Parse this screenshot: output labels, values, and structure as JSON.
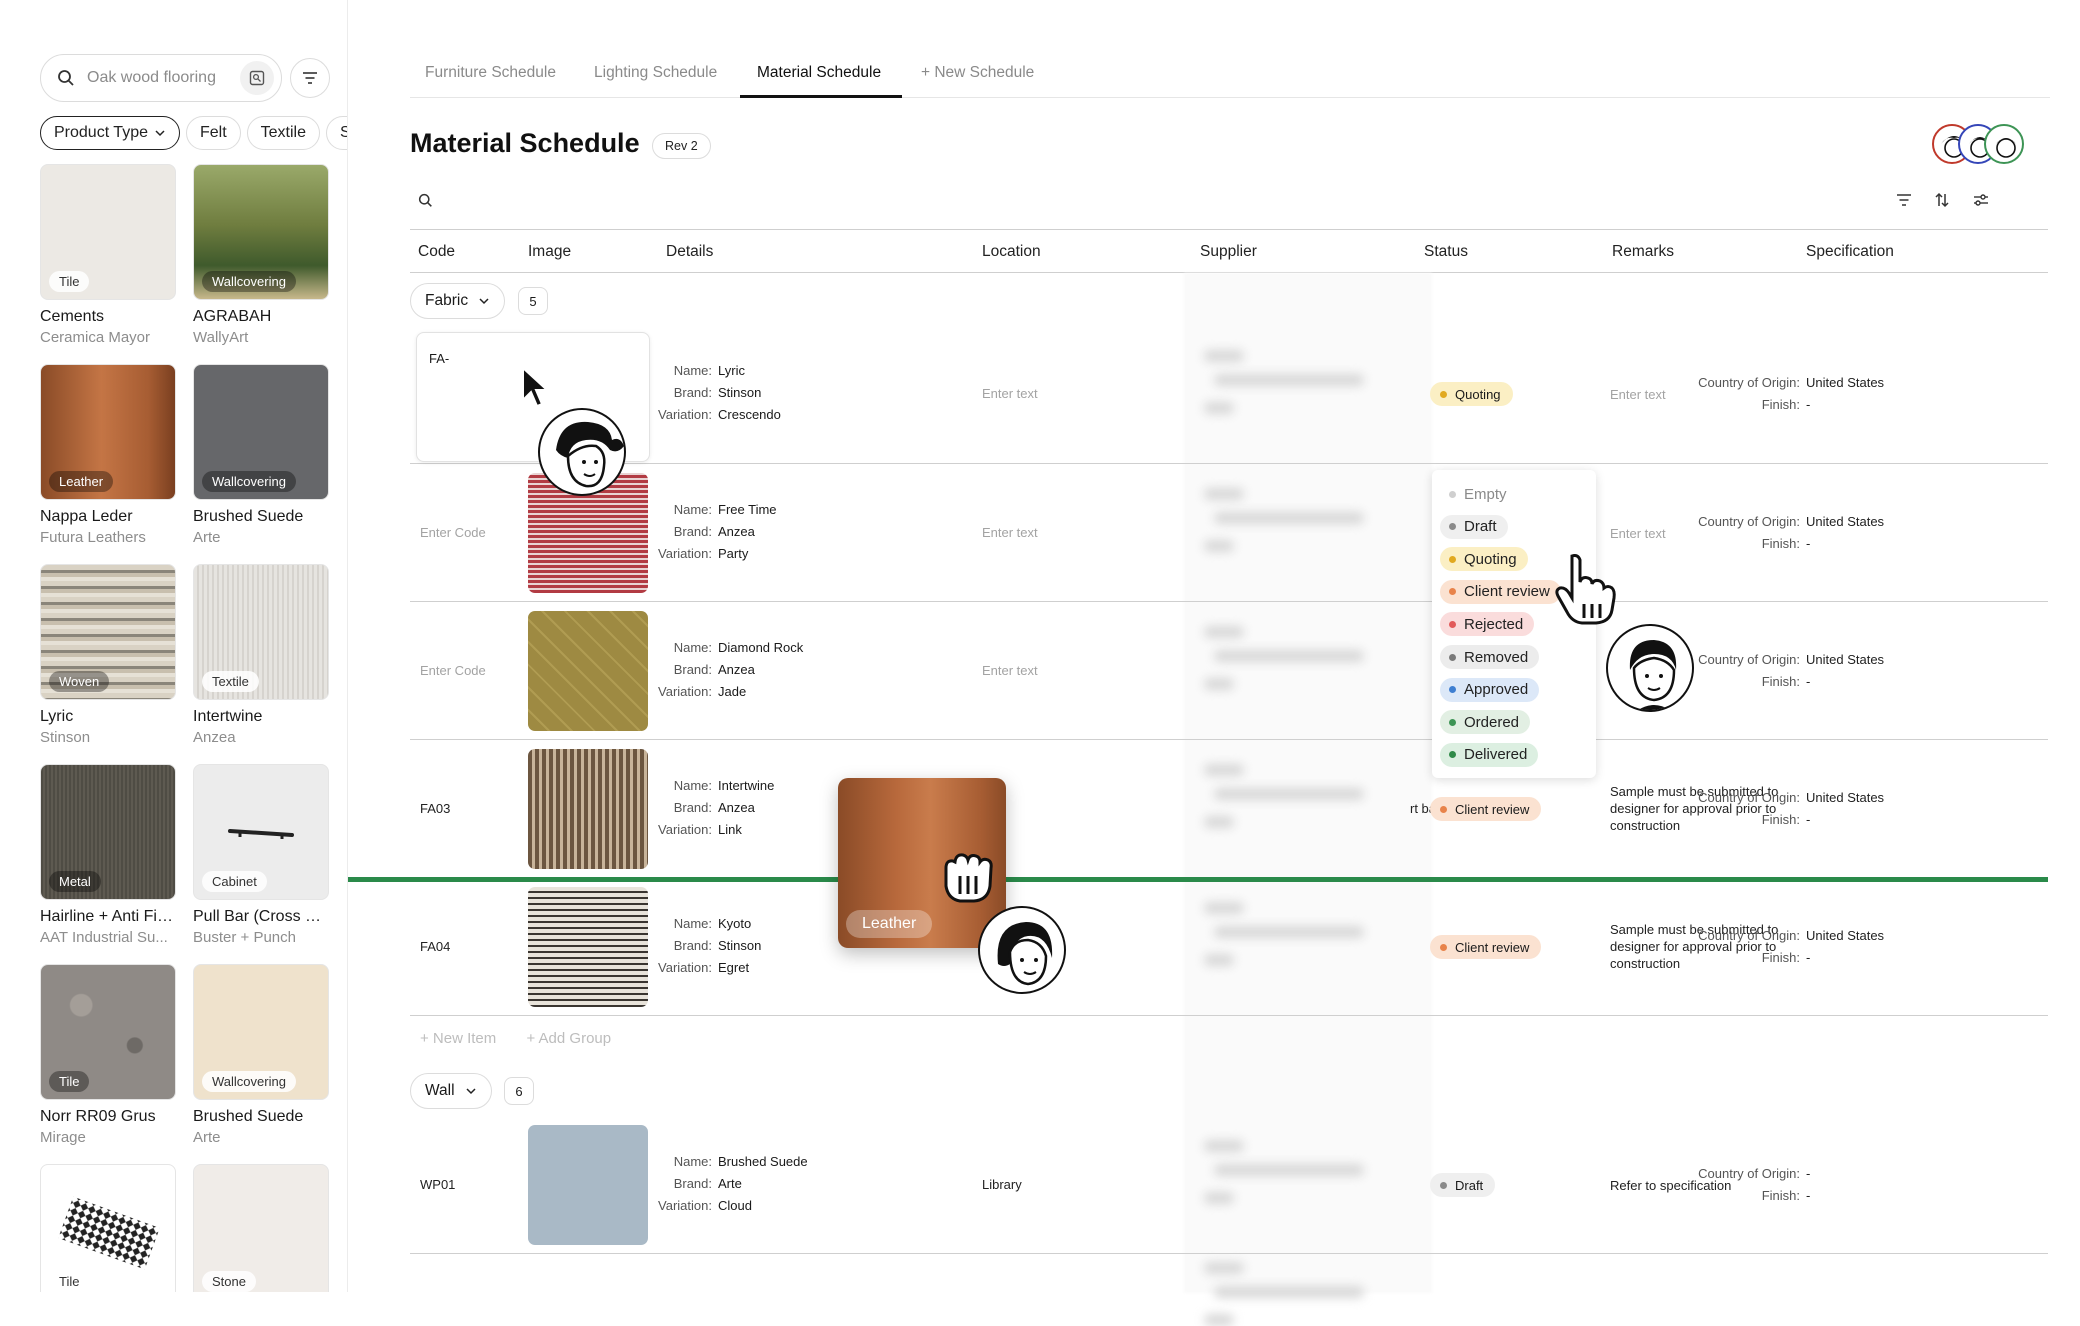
{
  "sidebar": {
    "search": {
      "placeholder": "Oak wood flooring"
    },
    "chips": [
      "Product Type",
      "Felt",
      "Textile",
      "S"
    ],
    "cards": [
      {
        "badge": "Tile",
        "name": "Cements",
        "brand": "Ceramica Mayor",
        "color": "#ece9e4"
      },
      {
        "badge": "Wallcovering",
        "name": "AGRABAH",
        "brand": "WallyArt",
        "color": "#5b6b3a"
      },
      {
        "badge": "Leather",
        "name": "Nappa Leder",
        "brand": "Futura Leathers",
        "color": "#a85a30"
      },
      {
        "badge": "Wallcovering",
        "name": "Brushed Suede",
        "brand": "Arte",
        "color": "#66676a"
      },
      {
        "badge": "Woven",
        "name": "Lyric",
        "brand": "Stinson",
        "color": "#b9b3a8"
      },
      {
        "badge": "Textile",
        "name": "Intertwine",
        "brand": "Anzea",
        "color": "#e4e2df"
      },
      {
        "badge": "Metal",
        "name": "Hairline + Anti Fin...",
        "brand": "AAT Industrial Su...",
        "color": "#55524a"
      },
      {
        "badge": "Cabinet",
        "name": "Pull Bar (Cross Bl...",
        "brand": "Buster + Punch",
        "color": "#ececec"
      },
      {
        "badge": "Tile",
        "name": "Norr RR09 Grus",
        "brand": "Mirage",
        "color": "#8f8a86"
      },
      {
        "badge": "Wallcovering",
        "name": "Brushed Suede",
        "brand": "Arte",
        "color": "#efe2cc"
      },
      {
        "badge": "Tile",
        "name": "",
        "brand": "",
        "color": "#ffffff"
      },
      {
        "badge": "Stone",
        "name": "",
        "brand": "",
        "color": "#f0ece8"
      }
    ]
  },
  "tabs": [
    "Furniture Schedule",
    "Lighting Schedule",
    "Material Schedule",
    "+ New Schedule"
  ],
  "page": {
    "title": "Material Schedule",
    "rev": "Rev 2"
  },
  "columns": [
    "Code",
    "Image",
    "Details",
    "Location",
    "Supplier",
    "Status",
    "Remarks",
    "Specification"
  ],
  "groups": [
    {
      "name": "Fabric",
      "count": "5"
    },
    {
      "name": "Wall",
      "count": "6"
    }
  ],
  "labels": {
    "name": "Name:",
    "brand": "Brand:",
    "variation": "Variation:",
    "country": "Country of Origin:",
    "finish": "Finish:",
    "enter_text": "Enter text",
    "enter_code": "Enter Code",
    "new_item": "+ New Item",
    "add_group": "+ Add Group"
  },
  "rows": [
    {
      "code": "FA-",
      "name": "Lyric",
      "brand": "Stinson",
      "variation": "Crescendo",
      "location": "",
      "status": "Quoting",
      "remarks": "",
      "country": "United States",
      "finish": "-"
    },
    {
      "code": "",
      "name": "Free Time",
      "brand": "Anzea",
      "variation": "Party",
      "location": "",
      "status": "",
      "remarks": "",
      "country": "United States",
      "finish": "-"
    },
    {
      "code": "",
      "name": "Diamond Rock",
      "brand": "Anzea",
      "variation": "Jade",
      "location": "",
      "status": "",
      "remarks": "",
      "country": "United States",
      "finish": "-"
    },
    {
      "code": "FA03",
      "name": "Intertwine",
      "brand": "Anzea",
      "variation": "Link",
      "location": "rt bar",
      "status": "Client review",
      "remarks": "Sample must be submitted to designer for approval prior to construction",
      "country": "United States",
      "finish": "-"
    },
    {
      "code": "FA04",
      "name": "Kyoto",
      "brand": "Stinson",
      "variation": "Egret",
      "location": "",
      "status": "Client review",
      "remarks": "Sample must be submitted to designer for approval prior to construction",
      "country": "United States",
      "finish": "-"
    },
    {
      "code": "WP01",
      "name": "Brushed Suede",
      "brand": "Arte",
      "variation": "Cloud",
      "location": "Library",
      "status": "Draft",
      "remarks": "Refer to specification",
      "country": "-",
      "finish": "-"
    }
  ],
  "status_options": [
    {
      "label": "Empty",
      "bg": "#ffffff",
      "dot": "#cfcfcf",
      "color": "#8a8a8a"
    },
    {
      "label": "Draft",
      "bg": "#efefef",
      "dot": "#8a8a8a",
      "color": "#222"
    },
    {
      "label": "Quoting",
      "bg": "#fbefc4",
      "dot": "#e1a920",
      "color": "#222"
    },
    {
      "label": "Client review",
      "bg": "#fbe2d1",
      "dot": "#e8834a",
      "color": "#222"
    },
    {
      "label": "Rejected",
      "bg": "#fadcdc",
      "dot": "#e25a5a",
      "color": "#222"
    },
    {
      "label": "Removed",
      "bg": "#ececec",
      "dot": "#7a7a7a",
      "color": "#222"
    },
    {
      "label": "Approved",
      "bg": "#dce8f8",
      "dot": "#3f7fd1",
      "color": "#222"
    },
    {
      "label": "Ordered",
      "bg": "#e2efe3",
      "dot": "#3d9455",
      "color": "#222"
    },
    {
      "label": "Delivered",
      "bg": "#dcefe1",
      "dot": "#2f8a48",
      "color": "#222"
    }
  ],
  "drag": {
    "badge": "Leather"
  },
  "colors": {
    "accent_line": "#2a8a4a"
  }
}
